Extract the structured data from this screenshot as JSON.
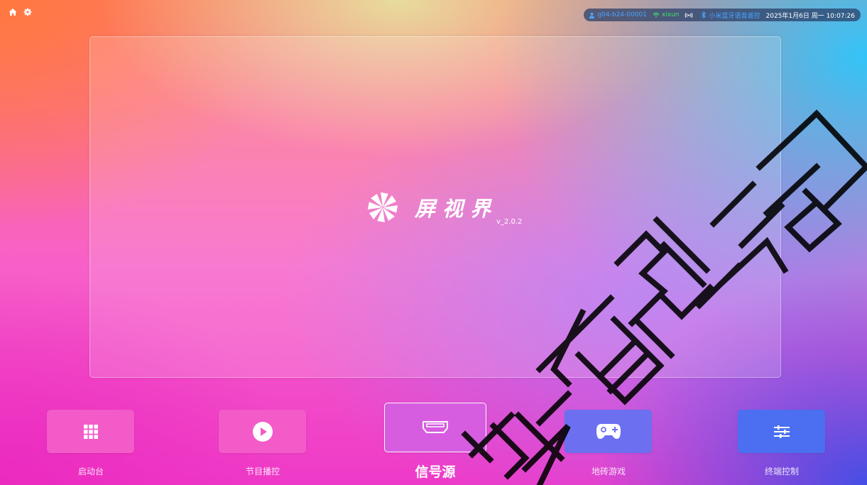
{
  "status_bar": {
    "user_icon": "user-icon",
    "device_id": "g04-b24-00001",
    "wifi_icon": "wifi-icon",
    "wifi_name": "xixun",
    "broadcast_icon": "broadcast-icon",
    "bluetooth_icon": "bluetooth-icon",
    "bluetooth_device": "小米蓝牙语音遥控",
    "datetime": "2025年1月6日 周一 10:07:26"
  },
  "top_left": {
    "home_icon": "home-icon",
    "settings_icon": "gear-icon"
  },
  "splash": {
    "logo_icon": "pinwheel-logo-icon",
    "app_name": "屏视界",
    "version": "v_2.0.2"
  },
  "dock": {
    "items": [
      {
        "label": "启动台",
        "icon": "grid-icon",
        "color": "#f25bc8",
        "selected": false
      },
      {
        "label": "节目播控",
        "icon": "play-icon",
        "color": "#f25bc8",
        "selected": false
      },
      {
        "label": "信号源",
        "icon": "hdmi-icon",
        "color": "#d75de0",
        "selected": true
      },
      {
        "label": "地砖游戏",
        "icon": "gamepad-icon",
        "color": "#6c6ff0",
        "selected": false
      },
      {
        "label": "终端控制",
        "icon": "sliders-icon",
        "color": "#4b6ff0",
        "selected": false
      }
    ]
  },
  "watermark": {
    "text": "科技有限公司"
  },
  "colors": {
    "status_text_blue": "#4aa3ff",
    "wifi_green": "#3fe06b",
    "pill_background": "#283c64"
  }
}
